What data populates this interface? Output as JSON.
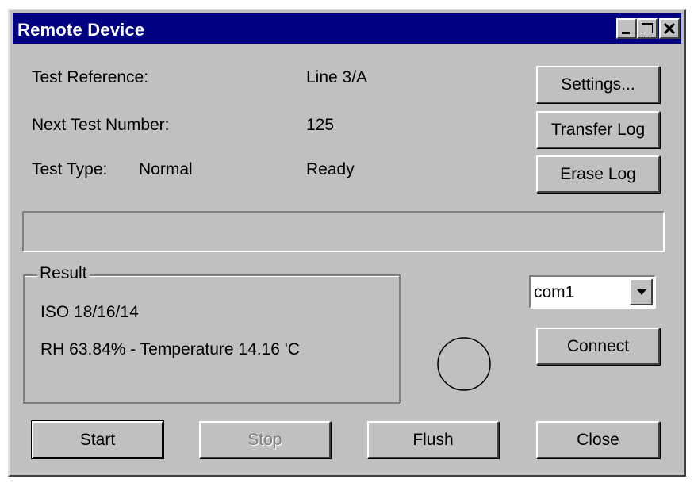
{
  "window": {
    "title": "Remote Device"
  },
  "info": {
    "test_reference_label": "Test Reference:",
    "test_reference_value": "Line 3/A",
    "next_test_number_label": "Next Test Number:",
    "next_test_number_value": "125",
    "test_type_label": "Test Type:",
    "test_type_value": "Normal",
    "status_value": "Ready"
  },
  "buttons": {
    "settings": "Settings...",
    "transfer_log": "Transfer Log",
    "erase_log": "Erase Log",
    "connect": "Connect",
    "start": "Start",
    "stop": "Stop",
    "flush": "Flush",
    "close": "Close"
  },
  "progress": {
    "value": 0
  },
  "result": {
    "group_label": "Result",
    "line1": "ISO 18/16/14",
    "line2": "RH 63.84% - Temperature 14.16 'C"
  },
  "port": {
    "selected": "com1"
  },
  "colors": {
    "titlebar": "#000080",
    "face": "#c0c0c0"
  },
  "icons": [
    "minimize-icon",
    "maximize-icon",
    "close-icon",
    "dropdown-arrow-icon",
    "status-indicator-circle"
  ]
}
